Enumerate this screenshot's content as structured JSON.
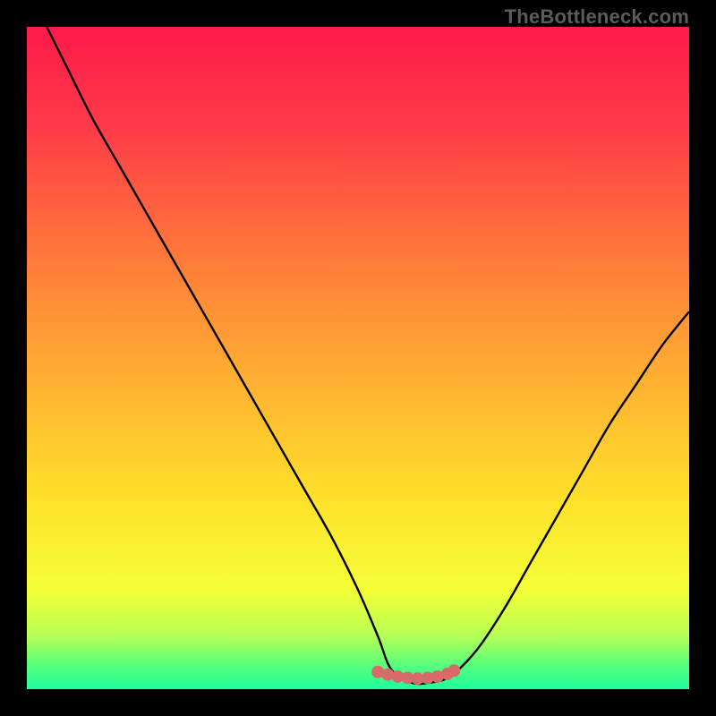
{
  "watermark": "TheBottleneck.com",
  "colors": {
    "frame": "#000000",
    "curve": "#000000",
    "marker": "#d86a6a",
    "gradient_stops": [
      {
        "offset": 0.0,
        "color": "#ff1a4b"
      },
      {
        "offset": 0.15,
        "color": "#ff3a48"
      },
      {
        "offset": 0.35,
        "color": "#ff7a3a"
      },
      {
        "offset": 0.55,
        "color": "#ffb531"
      },
      {
        "offset": 0.72,
        "color": "#ffe22a"
      },
      {
        "offset": 0.85,
        "color": "#f4ff36"
      },
      {
        "offset": 0.92,
        "color": "#b6ff55"
      },
      {
        "offset": 0.96,
        "color": "#5fff78"
      },
      {
        "offset": 1.0,
        "color": "#1cff9c"
      }
    ]
  },
  "chart_data": {
    "type": "line",
    "title": "",
    "xlabel": "",
    "ylabel": "",
    "xlim": [
      0,
      100
    ],
    "ylim": [
      0,
      100
    ],
    "grid": false,
    "series": [
      {
        "name": "bottleneck-curve",
        "x": [
          3,
          6,
          10,
          14,
          18,
          22,
          26,
          30,
          34,
          38,
          42,
          46,
          50,
          53,
          55,
          58,
          61,
          64,
          68,
          72,
          76,
          80,
          84,
          88,
          92,
          96,
          100
        ],
        "y": [
          100,
          94,
          86,
          79,
          72,
          65,
          58,
          51,
          44,
          37,
          30,
          23,
          15,
          8,
          3,
          1,
          1,
          2,
          6,
          12,
          19,
          26,
          33,
          40,
          46,
          52,
          57
        ]
      }
    ],
    "markers": {
      "name": "optimal-range",
      "x": [
        53.0,
        54.5,
        56.0,
        57.5,
        59.0,
        60.5,
        62.0,
        63.5,
        64.5
      ],
      "y": [
        2.6,
        2.2,
        1.9,
        1.7,
        1.6,
        1.7,
        1.9,
        2.3,
        2.8
      ]
    }
  }
}
